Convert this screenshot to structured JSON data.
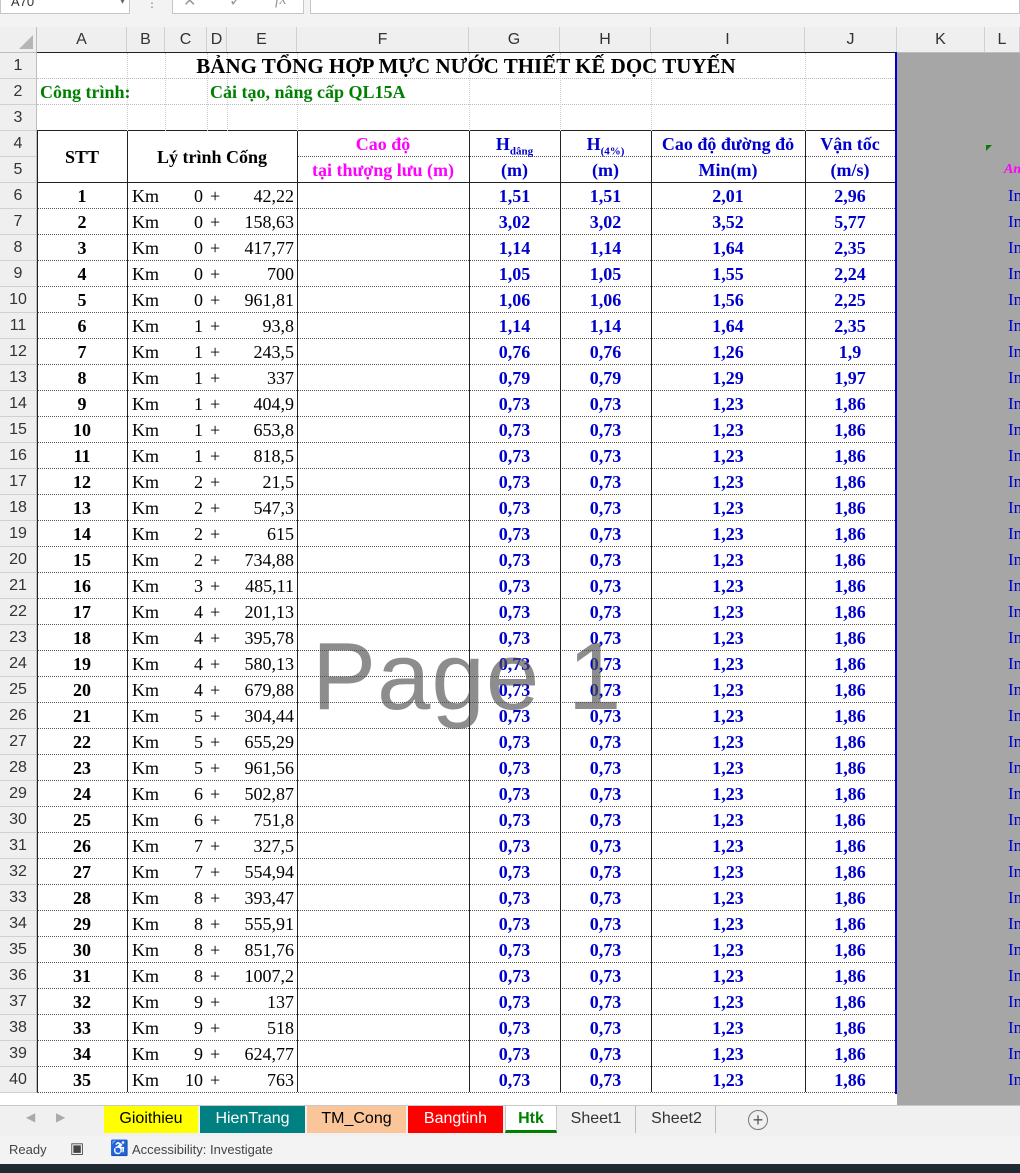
{
  "formula_bar": {
    "name_box": "A70",
    "cancel_icon": "close-icon",
    "enter_icon": "check-icon",
    "fx_label": "fx",
    "formula": ""
  },
  "columns": [
    "A",
    "B",
    "C",
    "D",
    "E",
    "F",
    "G",
    "H",
    "I",
    "J",
    "K",
    "L"
  ],
  "row_numbers": [
    "1",
    "2",
    "3",
    "4",
    "5",
    "6",
    "7",
    "8",
    "9",
    "10",
    "11",
    "12",
    "13",
    "14",
    "15",
    "16",
    "17",
    "18",
    "19",
    "20",
    "21",
    "22",
    "23",
    "24",
    "25",
    "26",
    "27",
    "28",
    "29",
    "30",
    "31",
    "32",
    "33",
    "34",
    "35",
    "36",
    "37",
    "38",
    "39",
    "40"
  ],
  "sheet": {
    "title": "BẢNG TỔNG HỢP MỰC NƯỚC THIẾT KẾ DỌC TUYẾN",
    "project_label": "Công trình:",
    "project_name": "Cải tạo, nâng cấp QL15A",
    "headers": {
      "stt": "STT",
      "ly_trinh": "Lý trình Cống",
      "cao_do_1": "Cao độ",
      "cao_do_2": "tại thượng lưu (m)",
      "h_dang_main": "H",
      "h_dang_sub": "dâng",
      "h_dang_unit": "(m)",
      "h4_main": "H",
      "h4_sub": "(4%)",
      "h4_unit": "(m)",
      "cao_do_duong_1": "Cao độ đường đỏ",
      "cao_do_duong_2": "Min(m)",
      "van_toc_1": "Vận tốc",
      "van_toc_2": "(m/s)",
      "side_label": "An"
    },
    "rows": [
      {
        "stt": "1",
        "km": "0",
        "plus": "42,22",
        "h": "1,51",
        "h4": "1,51",
        "min": "2,01",
        "v": "2,96"
      },
      {
        "stt": "2",
        "km": "0",
        "plus": "158,63",
        "h": "3,02",
        "h4": "3,02",
        "min": "3,52",
        "v": "5,77"
      },
      {
        "stt": "3",
        "km": "0",
        "plus": "417,77",
        "h": "1,14",
        "h4": "1,14",
        "min": "1,64",
        "v": "2,35"
      },
      {
        "stt": "4",
        "km": "0",
        "plus": "700",
        "h": "1,05",
        "h4": "1,05",
        "min": "1,55",
        "v": "2,24"
      },
      {
        "stt": "5",
        "km": "0",
        "plus": "961,81",
        "h": "1,06",
        "h4": "1,06",
        "min": "1,56",
        "v": "2,25"
      },
      {
        "stt": "6",
        "km": "1",
        "plus": "93,8",
        "h": "1,14",
        "h4": "1,14",
        "min": "1,64",
        "v": "2,35"
      },
      {
        "stt": "7",
        "km": "1",
        "plus": "243,5",
        "h": "0,76",
        "h4": "0,76",
        "min": "1,26",
        "v": "1,9"
      },
      {
        "stt": "8",
        "km": "1",
        "plus": "337",
        "h": "0,79",
        "h4": "0,79",
        "min": "1,29",
        "v": "1,97"
      },
      {
        "stt": "9",
        "km": "1",
        "plus": "404,9",
        "h": "0,73",
        "h4": "0,73",
        "min": "1,23",
        "v": "1,86"
      },
      {
        "stt": "10",
        "km": "1",
        "plus": "653,8",
        "h": "0,73",
        "h4": "0,73",
        "min": "1,23",
        "v": "1,86"
      },
      {
        "stt": "11",
        "km": "1",
        "plus": "818,5",
        "h": "0,73",
        "h4": "0,73",
        "min": "1,23",
        "v": "1,86"
      },
      {
        "stt": "12",
        "km": "2",
        "plus": "21,5",
        "h": "0,73",
        "h4": "0,73",
        "min": "1,23",
        "v": "1,86"
      },
      {
        "stt": "13",
        "km": "2",
        "plus": "547,3",
        "h": "0,73",
        "h4": "0,73",
        "min": "1,23",
        "v": "1,86"
      },
      {
        "stt": "14",
        "km": "2",
        "plus": "615",
        "h": "0,73",
        "h4": "0,73",
        "min": "1,23",
        "v": "1,86"
      },
      {
        "stt": "15",
        "km": "2",
        "plus": "734,88",
        "h": "0,73",
        "h4": "0,73",
        "min": "1,23",
        "v": "1,86"
      },
      {
        "stt": "16",
        "km": "3",
        "plus": "485,11",
        "h": "0,73",
        "h4": "0,73",
        "min": "1,23",
        "v": "1,86"
      },
      {
        "stt": "17",
        "km": "4",
        "plus": "201,13",
        "h": "0,73",
        "h4": "0,73",
        "min": "1,23",
        "v": "1,86"
      },
      {
        "stt": "18",
        "km": "4",
        "plus": "395,78",
        "h": "0,73",
        "h4": "0,73",
        "min": "1,23",
        "v": "1,86"
      },
      {
        "stt": "19",
        "km": "4",
        "plus": "580,13",
        "h": "0,73",
        "h4": "0,73",
        "min": "1,23",
        "v": "1,86"
      },
      {
        "stt": "20",
        "km": "4",
        "plus": "679,88",
        "h": "0,73",
        "h4": "0,73",
        "min": "1,23",
        "v": "1,86"
      },
      {
        "stt": "21",
        "km": "5",
        "plus": "304,44",
        "h": "0,73",
        "h4": "0,73",
        "min": "1,23",
        "v": "1,86"
      },
      {
        "stt": "22",
        "km": "5",
        "plus": "655,29",
        "h": "0,73",
        "h4": "0,73",
        "min": "1,23",
        "v": "1,86"
      },
      {
        "stt": "23",
        "km": "5",
        "plus": "961,56",
        "h": "0,73",
        "h4": "0,73",
        "min": "1,23",
        "v": "1,86"
      },
      {
        "stt": "24",
        "km": "6",
        "plus": "502,87",
        "h": "0,73",
        "h4": "0,73",
        "min": "1,23",
        "v": "1,86"
      },
      {
        "stt": "25",
        "km": "6",
        "plus": "751,8",
        "h": "0,73",
        "h4": "0,73",
        "min": "1,23",
        "v": "1,86"
      },
      {
        "stt": "26",
        "km": "7",
        "plus": "327,5",
        "h": "0,73",
        "h4": "0,73",
        "min": "1,23",
        "v": "1,86"
      },
      {
        "stt": "27",
        "km": "7",
        "plus": "554,94",
        "h": "0,73",
        "h4": "0,73",
        "min": "1,23",
        "v": "1,86"
      },
      {
        "stt": "28",
        "km": "8",
        "plus": "393,47",
        "h": "0,73",
        "h4": "0,73",
        "min": "1,23",
        "v": "1,86"
      },
      {
        "stt": "29",
        "km": "8",
        "plus": "555,91",
        "h": "0,73",
        "h4": "0,73",
        "min": "1,23",
        "v": "1,86"
      },
      {
        "stt": "30",
        "km": "8",
        "plus": "851,76",
        "h": "0,73",
        "h4": "0,73",
        "min": "1,23",
        "v": "1,86"
      },
      {
        "stt": "31",
        "km": "8",
        "plus": "1007,2",
        "h": "0,73",
        "h4": "0,73",
        "min": "1,23",
        "v": "1,86"
      },
      {
        "stt": "32",
        "km": "9",
        "plus": "137",
        "h": "0,73",
        "h4": "0,73",
        "min": "1,23",
        "v": "1,86"
      },
      {
        "stt": "33",
        "km": "9",
        "plus": "518",
        "h": "0,73",
        "h4": "0,73",
        "min": "1,23",
        "v": "1,86"
      },
      {
        "stt": "34",
        "km": "9",
        "plus": "624,77",
        "h": "0,73",
        "h4": "0,73",
        "min": "1,23",
        "v": "1,86"
      },
      {
        "stt": "35",
        "km": "10",
        "plus": "763",
        "h": "0,73",
        "h4": "0,73",
        "min": "1,23",
        "v": "1,86"
      }
    ],
    "km_label": "Km",
    "plus_sign": "+",
    "side_cell": "In"
  },
  "watermark": "Page 1",
  "tabs": [
    {
      "label": "Gioithieu",
      "bg": "#ffff00",
      "fg": "#000000"
    },
    {
      "label": "HienTrang",
      "bg": "#008080",
      "fg": "#ffffff"
    },
    {
      "label": "TM_Cong",
      "bg": "#fbc59a",
      "fg": "#000000"
    },
    {
      "label": "Bangtinh",
      "bg": "#ff0000",
      "fg": "#ffffff"
    },
    {
      "label": "Htk",
      "bg": "#ffffff",
      "fg": "#008000",
      "active": true
    },
    {
      "label": "Sheet1",
      "bg": "#f0f0f0",
      "fg": "#333333"
    },
    {
      "label": "Sheet2",
      "bg": "#f0f0f0",
      "fg": "#333333"
    }
  ],
  "status_bar": {
    "ready": "Ready",
    "accessibility": "Accessibility: Investigate"
  },
  "colors": {
    "blue_value": "#0000cc",
    "header_magenta": "#ff00ff",
    "project_green": "#008000",
    "border_blue": "#0000cc"
  }
}
